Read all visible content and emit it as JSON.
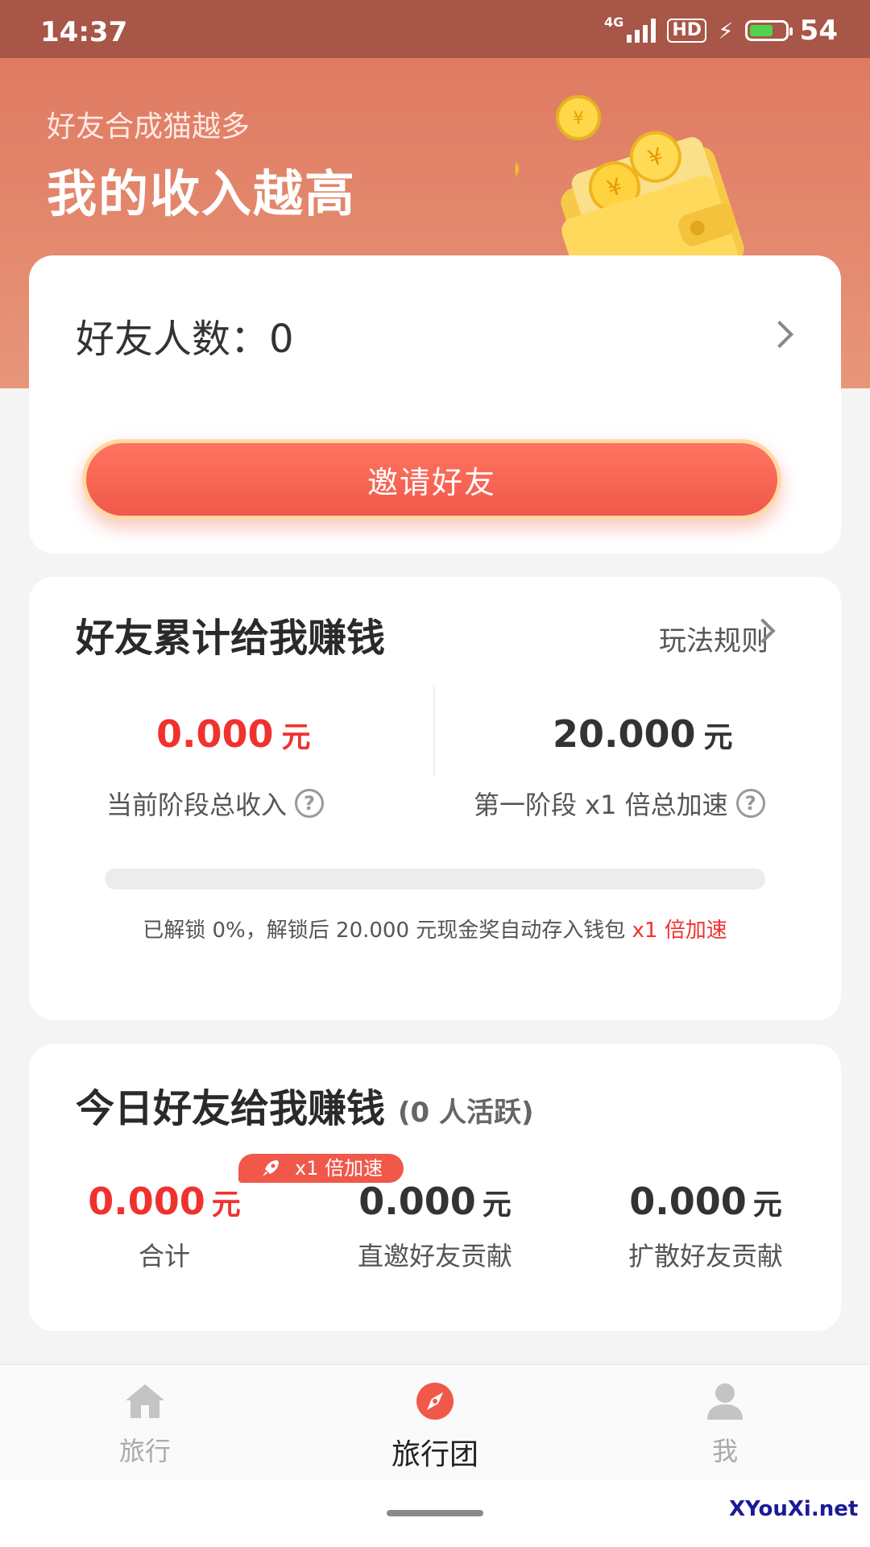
{
  "status_bar": {
    "time": "14:37",
    "network": "4G",
    "hd": "HD",
    "battery": "54",
    "colors": {
      "background": "#a85647",
      "battery_fill": "#4fd34f"
    }
  },
  "header": {
    "subtitle": "好友合成猫越多",
    "title": "我的收入越高"
  },
  "friends_card": {
    "count_label": "好友人数：0",
    "invite_button": "邀请好友"
  },
  "cumulative_card": {
    "title": "好友累计给我赚钱",
    "rules_link": "玩法规则",
    "current_amount": "0.000",
    "current_unit": "元",
    "current_label": "当前阶段总收入",
    "stage_amount": "20.000",
    "stage_unit": "元",
    "stage_label": "第一阶段 x1 倍总加速",
    "help_icon_glyph": "?",
    "progress_percent": 0,
    "note": "已解锁 0%，解锁后 20.000 元现金奖自动存入钱包 ",
    "note_highlight": "x1 倍加速"
  },
  "today_card": {
    "title": "今日好友给我赚钱",
    "active_tag": "(0 人活跃)",
    "speed_badge": "x1 倍加速",
    "columns": [
      {
        "amount": "0.000",
        "unit": "元",
        "label": "合计"
      },
      {
        "amount": "0.000",
        "unit": "元",
        "label": "直邀好友贡献"
      },
      {
        "amount": "0.000",
        "unit": "元",
        "label": "扩散好友贡献"
      }
    ]
  },
  "bottom_nav": {
    "items": [
      {
        "label": "旅行",
        "icon": "home-icon"
      },
      {
        "label": "旅行团",
        "icon": "compass-icon"
      },
      {
        "label": "我",
        "icon": "user-icon"
      }
    ],
    "active_index": 1,
    "accent": "#f0584a"
  },
  "watermark": "XYouXi.net"
}
